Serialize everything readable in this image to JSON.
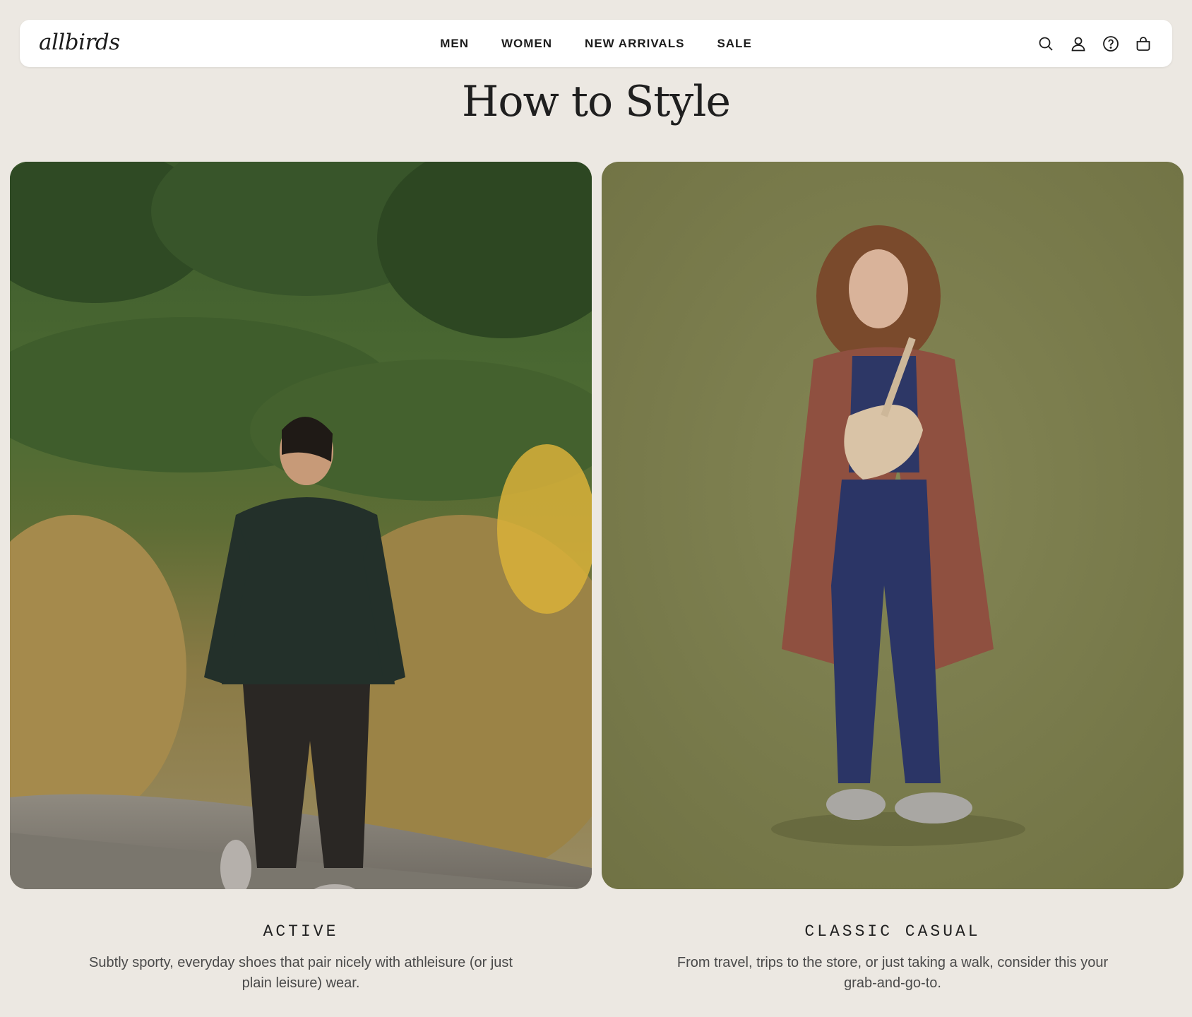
{
  "brand": {
    "logo_text": "allbirds"
  },
  "nav": {
    "items": [
      {
        "label": "MEN"
      },
      {
        "label": "WOMEN"
      },
      {
        "label": "NEW ARRIVALS"
      },
      {
        "label": "SALE"
      }
    ]
  },
  "header_icons": [
    "search-icon",
    "account-icon",
    "help-icon",
    "cart-icon"
  ],
  "page": {
    "title": "How to Style"
  },
  "styles": [
    {
      "title": "ACTIVE",
      "description": "Subtly sporty, everyday shoes that pair nicely with athleisure (or just plain leisure) wear.",
      "image_subject": "Woman in dark green jacket and black cropped pants walking on a gravel path among tall grasses"
    },
    {
      "title": "CLASSIC CASUAL",
      "description": "From travel, trips to the store, or just taking a walk, consider this your grab-and-go-to.",
      "image_subject": "Woman in rust coat, navy hoodie and joggers with a beige belt bag against an olive backdrop"
    }
  ],
  "colors": {
    "page_background": "#ece8e2",
    "header_background": "#ffffff",
    "text_primary": "#212121",
    "text_secondary": "#4a4a4a",
    "olive_backdrop": "#7b7c4a"
  }
}
